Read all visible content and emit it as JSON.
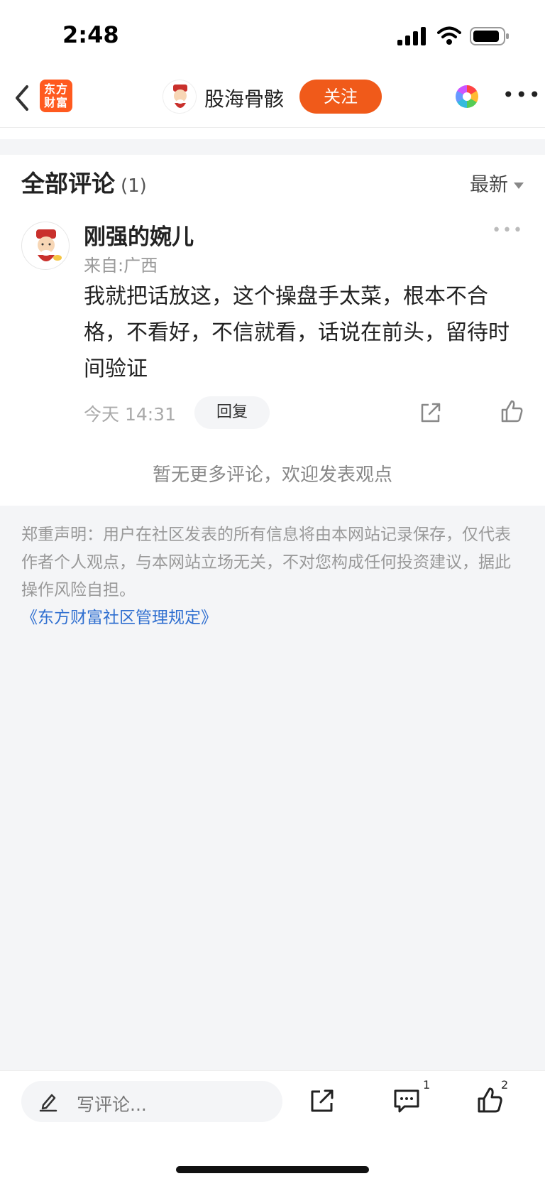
{
  "status_bar": {
    "time": "2:48"
  },
  "header": {
    "app_logo_text": "东方财富",
    "author_name": "股海骨骸",
    "follow_label": "关注"
  },
  "comments_section": {
    "title": "全部评论",
    "count": "(1)",
    "sort_label": "最新",
    "comments": [
      {
        "user": "刚强的婉儿",
        "location": "来自:广西",
        "text": "我就把话放这，这个操盘手太菜，根本不合格，不看好，不信就看，话说在前头，留待时间验证",
        "time": "今天 14:31",
        "reply_label": "回复"
      }
    ],
    "no_more": "暂无更多评论，欢迎发表观点"
  },
  "disclaimer": {
    "text": "郑重声明：用户在社区发表的所有信息将由本网站记录保存，仅代表作者个人观点，与本网站立场无关，不对您构成任何投资建议，据此操作风险自担。",
    "rules_link": "《东方财富社区管理规定》"
  },
  "bottom_bar": {
    "input_placeholder": "写评论...",
    "comment_count": "1",
    "like_count": "2"
  },
  "colors": {
    "accent": "#f05a1a",
    "link": "#2f6fd0",
    "muted": "#999999",
    "background_grey": "#f4f5f7"
  }
}
